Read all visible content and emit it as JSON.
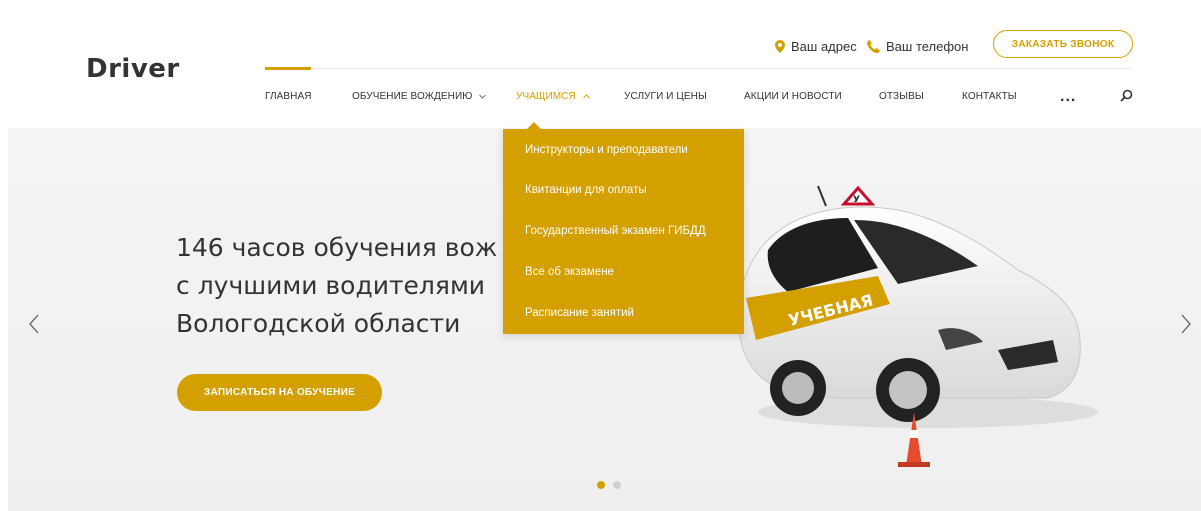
{
  "brand": {
    "logo": "Driver"
  },
  "top_bar": {
    "address": "Ваш адрес",
    "phone": "Ваш телефон",
    "callback_button": "ЗАКАЗАТЬ ЗВОНОК"
  },
  "nav": {
    "items": [
      {
        "label": "ГЛАВНАЯ"
      },
      {
        "label": "ОБУЧЕНИЕ ВОЖДЕНИЮ"
      },
      {
        "label": "УЧАЩИМСЯ"
      },
      {
        "label": "УСЛУГИ И ЦЕНЫ"
      },
      {
        "label": "АКЦИИ И НОВОСТИ"
      },
      {
        "label": "ОТЗЫВЫ"
      },
      {
        "label": "КОНТАКТЫ"
      }
    ],
    "more": "...",
    "active_item": "ГЛАВНАЯ",
    "open_dropdown": "УЧАЩИМСЯ"
  },
  "dropdown": {
    "items": [
      {
        "label": "Инструкторы и преподаватели"
      },
      {
        "label": "Квитанции для оплаты"
      },
      {
        "label": "Государственный экзамен ГИБДД"
      },
      {
        "label": "Все об экзамене"
      },
      {
        "label": "Расписание занятий"
      }
    ]
  },
  "hero": {
    "headline_lines": [
      "146 часов обучения вож",
      "с лучшими водителями",
      "Вологодской области"
    ],
    "cta": "ЗАПИСАТЬСЯ НА ОБУЧЕНИЕ",
    "car_label": "УЧЕБНАЯ",
    "car_sign": "У",
    "slides_total": 2,
    "slide_active": 1
  },
  "colors": {
    "accent": "#d4a000",
    "text": "#333333",
    "hero_bg": "#f2f2f2",
    "dot_inactive": "#d0d0d0"
  },
  "icons": [
    "location-pin-icon",
    "phone-icon",
    "chevron-down-icon",
    "chevron-up-icon",
    "search-icon",
    "arrow-left-icon",
    "arrow-right-icon"
  ]
}
